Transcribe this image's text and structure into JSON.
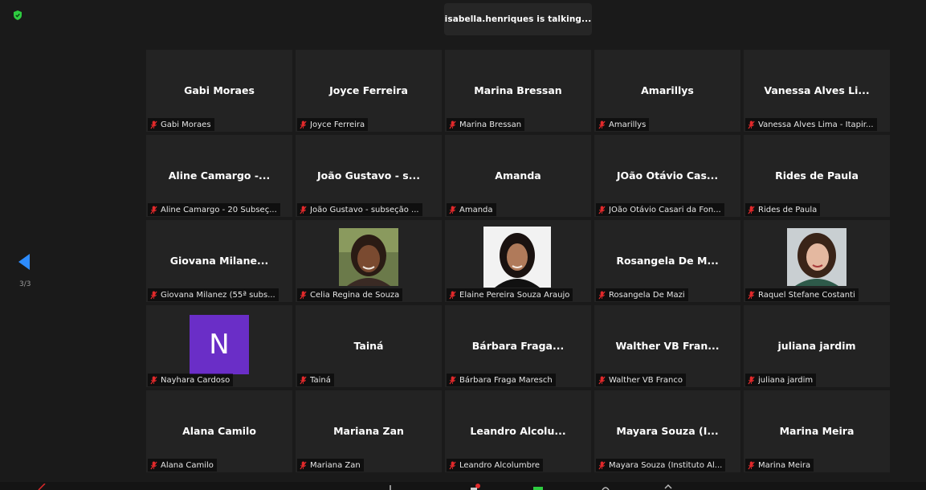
{
  "status": {
    "talking_text": "isabella.henriques is talking..."
  },
  "pagination": {
    "indicator": "3/3"
  },
  "colors": {
    "mic_muted": "#e0292b",
    "avatar_purple": "#6a2ec7",
    "shield": "#2ecc40",
    "arrow": "#2d8cff"
  },
  "tiles": [
    {
      "name": "Gabi Moraes",
      "label": "Gabi Moraes"
    },
    {
      "name": "Joyce Ferreira",
      "label": "Joyce Ferreira"
    },
    {
      "name": "Marina Bressan",
      "label": "Marina Bressan"
    },
    {
      "name": "Amarillys",
      "label": "Amarillys"
    },
    {
      "name": "Vanessa Alves Li...",
      "label": "Vanessa Alves Lima - Itapir..."
    },
    {
      "name": "Aline Camargo -...",
      "label": "Aline Camargo - 20 Subseç..."
    },
    {
      "name": "João Gustavo - s...",
      "label": "João Gustavo - subseção ..."
    },
    {
      "name": "Amanda",
      "label": "Amanda"
    },
    {
      "name": "JOão Otávio Cas...",
      "label": "JOão Otávio Casari da Fon..."
    },
    {
      "name": "Rides de Paula",
      "label": "Rides de Paula"
    },
    {
      "name": "Giovana Milane...",
      "label": "Giovana Milanez (55ª subs..."
    },
    {
      "name": "",
      "label": "Celia Regina de Souza"
    },
    {
      "name": "",
      "label": "Elaine Pereira Souza Araujo"
    },
    {
      "name": "Rosangela De M...",
      "label": "Rosangela De Mazi"
    },
    {
      "name": "",
      "label": "Raquel Stefane Costanti"
    },
    {
      "name": "",
      "label": "Nayhara Cardoso",
      "avatar_letter": "N"
    },
    {
      "name": "Tainá",
      "label": "Tainá"
    },
    {
      "name": "Bárbara Fraga...",
      "label": "Bárbara Fraga Maresch"
    },
    {
      "name": "Walther VB Fran...",
      "label": "Walther VB Franco"
    },
    {
      "name": "juliana jardim",
      "label": "juliana jardim"
    },
    {
      "name": "Alana Camilo",
      "label": "Alana Camilo"
    },
    {
      "name": "Mariana Zan",
      "label": "Mariana Zan"
    },
    {
      "name": "Leandro Alcolu...",
      "label": "Leandro Alcolumbre"
    },
    {
      "name": "Mayara Souza (I...",
      "label": "Mayara Souza (Instituto Al..."
    },
    {
      "name": "Marina Meira",
      "label": "Marina Meira"
    }
  ]
}
